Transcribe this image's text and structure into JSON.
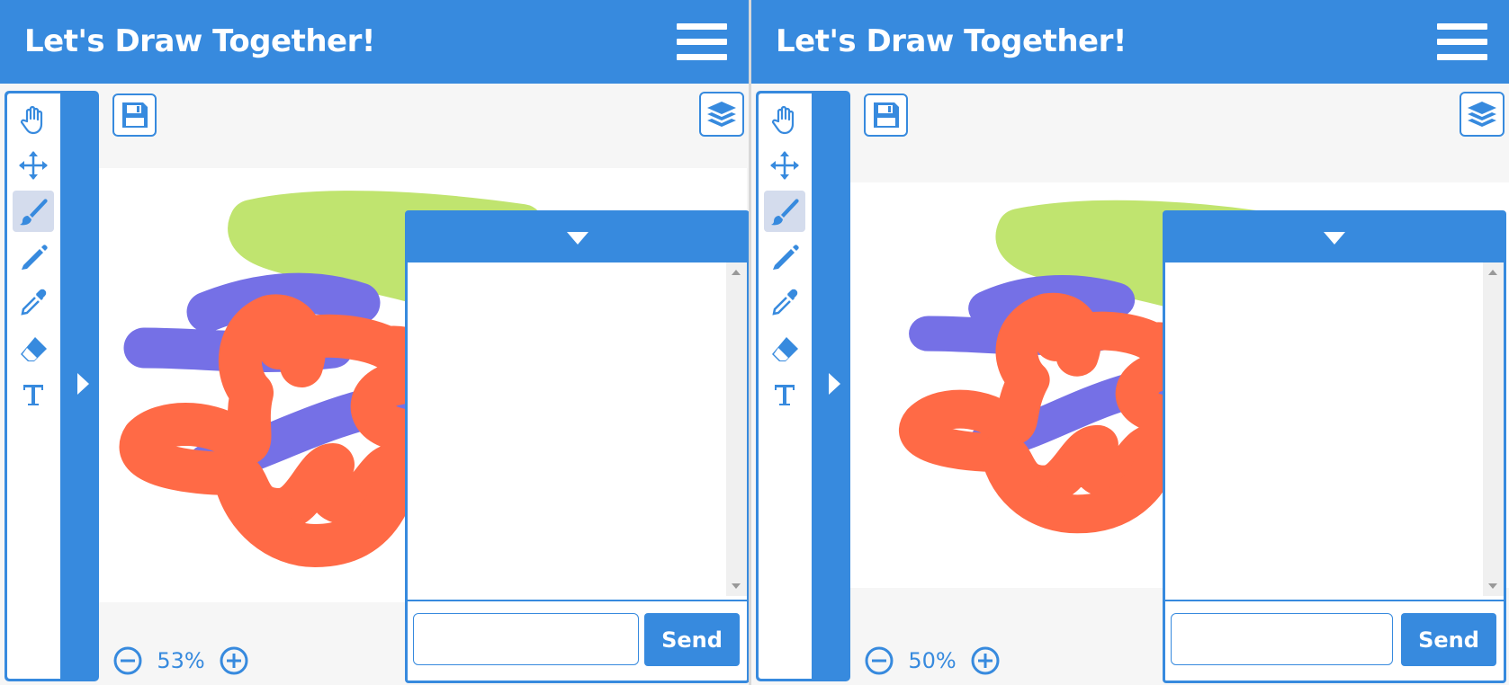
{
  "app": {
    "title": "Let's Draw Together!",
    "accent_color": "#378ade",
    "active_tool_bg": "#d4dced"
  },
  "toolbar": {
    "tools": [
      {
        "icon": "hand-icon",
        "name": "pan"
      },
      {
        "icon": "move-arrows-icon",
        "name": "move"
      },
      {
        "icon": "brush-icon",
        "name": "brush",
        "active": true
      },
      {
        "icon": "pencil-icon",
        "name": "pencil"
      },
      {
        "icon": "eyedropper-icon",
        "name": "color-picker"
      },
      {
        "icon": "eraser-icon",
        "name": "eraser"
      },
      {
        "icon": "text-icon",
        "name": "text"
      }
    ],
    "toggle_icon": "triangle-right-icon"
  },
  "top_controls": {
    "save_icon": "floppy-disk-icon",
    "layers_icon": "layers-icon"
  },
  "panes": [
    {
      "zoom_label": "53%",
      "chat_send_label": "Send",
      "chat_input_value": "",
      "chat_collapse_icon": "triangle-down-icon"
    },
    {
      "zoom_label": "50%",
      "chat_send_label": "Send",
      "chat_input_value": "",
      "chat_collapse_icon": "triangle-down-icon"
    }
  ],
  "drawing": {
    "stroke_colors": {
      "green": "#c0e46f",
      "purple": "#7570e6",
      "orange": "#ff6a46"
    }
  }
}
